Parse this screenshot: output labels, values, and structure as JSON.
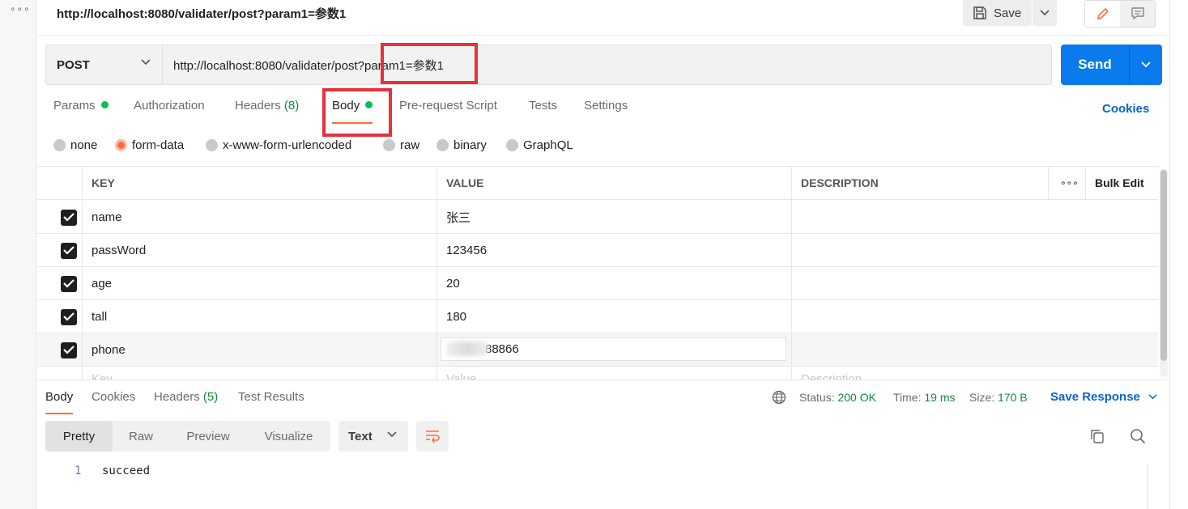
{
  "left_rail": {
    "menu_glyph": "∘∘∘"
  },
  "header": {
    "request_title": "http://localhost:8080/validater/post?param1=参数1",
    "save_label": "Save"
  },
  "request": {
    "method": "POST",
    "url": "http://localhost:8080/validater/post?param1=参数1",
    "send_label": "Send"
  },
  "request_tabs": {
    "params": "Params",
    "authorization": "Authorization",
    "headers": "Headers",
    "headers_count": "(8)",
    "body": "Body",
    "pre_request": "Pre-request Script",
    "tests": "Tests",
    "settings": "Settings",
    "cookies": "Cookies"
  },
  "body_types": {
    "none": "none",
    "form_data": "form-data",
    "urlencoded": "x-www-form-urlencoded",
    "raw": "raw",
    "binary": "binary",
    "graphql": "GraphQL",
    "selected": "form-data"
  },
  "form_table": {
    "headers": {
      "key": "KEY",
      "value": "VALUE",
      "description": "DESCRIPTION",
      "more": "∘∘∘",
      "bulk_edit": "Bulk Edit"
    },
    "rows": [
      {
        "key": "name",
        "value": "张三",
        "checked": true
      },
      {
        "key": "passWord",
        "value": "123456",
        "checked": true
      },
      {
        "key": "age",
        "value": "20",
        "checked": true
      },
      {
        "key": "tall",
        "value": "180",
        "checked": true
      },
      {
        "key": "phone",
        "value": "88866",
        "checked": true
      }
    ],
    "placeholder": {
      "key": "Key",
      "value": "Value",
      "description": "Description"
    }
  },
  "response": {
    "tabs": {
      "body": "Body",
      "cookies": "Cookies",
      "headers": "Headers",
      "headers_count": "(5)",
      "test_results": "Test Results"
    },
    "status_label": "Status:",
    "status_value": "200 OK",
    "time_label": "Time:",
    "time_value": "19 ms",
    "size_label": "Size:",
    "size_value": "170 B",
    "save_response": "Save Response",
    "views": {
      "pretty": "Pretty",
      "raw": "Raw",
      "preview": "Preview",
      "visualize": "Visualize"
    },
    "format": "Text",
    "lines": [
      {
        "num": "1",
        "text": "succeed"
      }
    ]
  },
  "colors": {
    "accent_orange": "#ff6c37",
    "send_blue": "#097bed",
    "link_blue": "#0b63d0",
    "status_green": "#0f8a3e",
    "highlight_red": "#e8313a"
  }
}
